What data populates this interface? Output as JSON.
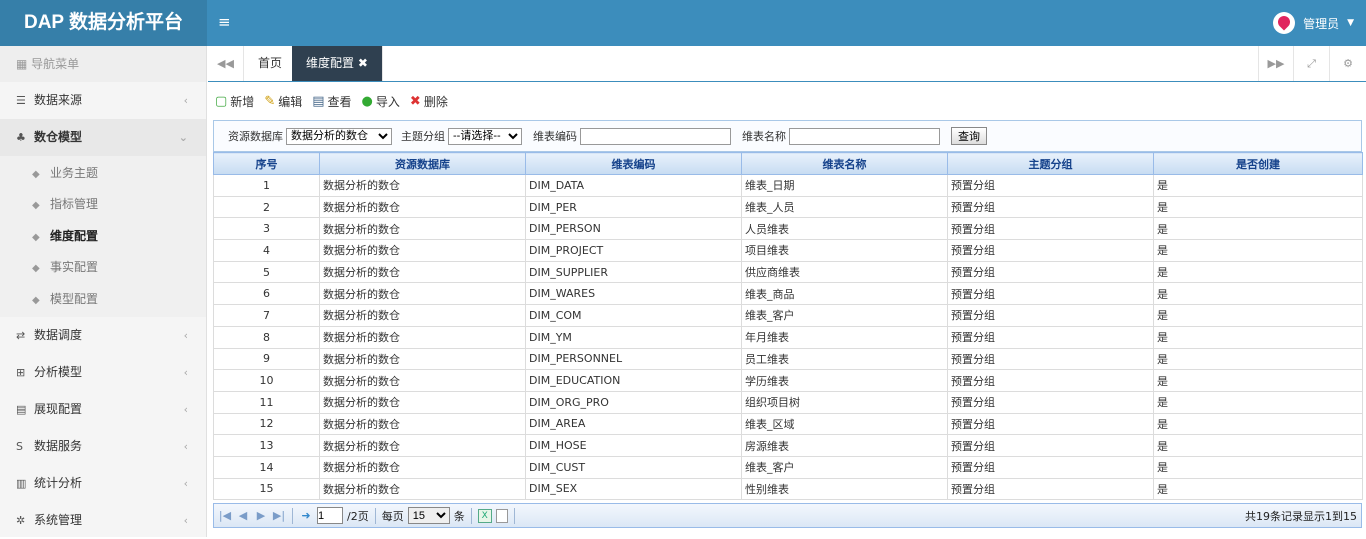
{
  "app": {
    "title": "DAP 数据分析平台",
    "user": "管理员"
  },
  "sidebar": {
    "header": "导航菜单",
    "items": [
      {
        "label": "数据来源"
      },
      {
        "label": "数仓模型"
      },
      {
        "label": "数据调度"
      },
      {
        "label": "分析模型"
      },
      {
        "label": "展现配置"
      },
      {
        "label": "数据服务"
      },
      {
        "label": "统计分析"
      },
      {
        "label": "系统管理"
      }
    ],
    "sub": [
      "业务主题",
      "指标管理",
      "维度配置",
      "事实配置",
      "模型配置"
    ]
  },
  "tabs": {
    "home": "首页",
    "active": "维度配置"
  },
  "toolbar": {
    "add": "新增",
    "edit": "编辑",
    "view": "查看",
    "import": "导入",
    "delete": "删除"
  },
  "search": {
    "db_label": "资源数据库",
    "db_value": "数据分析的数仓",
    "group_label": "主题分组",
    "group_value": "--请选择--",
    "code_label": "维表编码",
    "name_label": "维表名称",
    "query": "查询"
  },
  "table": {
    "headers": [
      "序号",
      "资源数据库",
      "维表编码",
      "维表名称",
      "主题分组",
      "是否创建"
    ],
    "rows": [
      [
        "1",
        "数据分析的数仓",
        "DIM_DATA",
        "维表_日期",
        "预置分组",
        "是"
      ],
      [
        "2",
        "数据分析的数仓",
        "DIM_PER",
        "维表_人员",
        "预置分组",
        "是"
      ],
      [
        "3",
        "数据分析的数仓",
        "DIM_PERSON",
        "人员维表",
        "预置分组",
        "是"
      ],
      [
        "4",
        "数据分析的数仓",
        "DIM_PROJECT",
        "项目维表",
        "预置分组",
        "是"
      ],
      [
        "5",
        "数据分析的数仓",
        "DIM_SUPPLIER",
        "供应商维表",
        "预置分组",
        "是"
      ],
      [
        "6",
        "数据分析的数仓",
        "DIM_WARES",
        "维表_商品",
        "预置分组",
        "是"
      ],
      [
        "7",
        "数据分析的数仓",
        "DIM_COM",
        "维表_客户",
        "预置分组",
        "是"
      ],
      [
        "8",
        "数据分析的数仓",
        "DIM_YM",
        "年月维表",
        "预置分组",
        "是"
      ],
      [
        "9",
        "数据分析的数仓",
        "DIM_PERSONNEL",
        "员工维表",
        "预置分组",
        "是"
      ],
      [
        "10",
        "数据分析的数仓",
        "DIM_EDUCATION",
        "学历维表",
        "预置分组",
        "是"
      ],
      [
        "11",
        "数据分析的数仓",
        "DIM_ORG_PRO",
        "组织项目树",
        "预置分组",
        "是"
      ],
      [
        "12",
        "数据分析的数仓",
        "DIM_AREA",
        "维表_区域",
        "预置分组",
        "是"
      ],
      [
        "13",
        "数据分析的数仓",
        "DIM_HOSE",
        "房源维表",
        "预置分组",
        "是"
      ],
      [
        "14",
        "数据分析的数仓",
        "DIM_CUST",
        "维表_客户",
        "预置分组",
        "是"
      ],
      [
        "15",
        "数据分析的数仓",
        "DIM_SEX",
        "性别维表",
        "预置分组",
        "是"
      ]
    ]
  },
  "pager": {
    "page": "1",
    "total_pages": "/2页",
    "per_page_label": "每页",
    "per_page": "15",
    "unit": "条",
    "info": "共19条记录显示1到15"
  }
}
